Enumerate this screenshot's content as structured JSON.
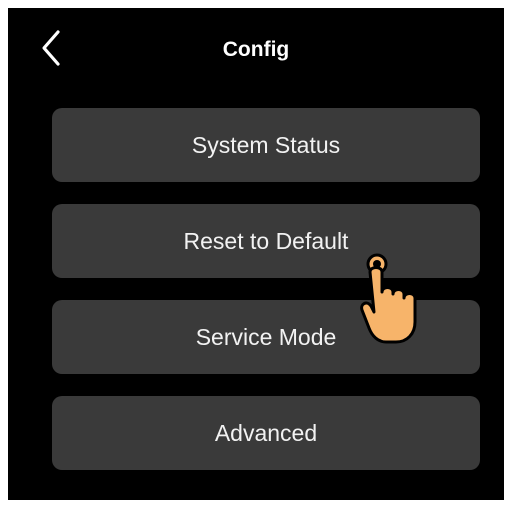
{
  "header": {
    "title": "Config",
    "back_icon": "chevron-left-icon"
  },
  "menu": {
    "items": [
      {
        "label": "System Status"
      },
      {
        "label": "Reset to Default"
      },
      {
        "label": "Service Mode"
      },
      {
        "label": "Advanced"
      }
    ]
  },
  "overlay": {
    "icon": "tap-hand-icon",
    "target": "Reset to Default"
  },
  "colors": {
    "background": "#000000",
    "button": "#3a3a3a",
    "text": "#ffffff",
    "hand_fill": "#f7b46a"
  }
}
